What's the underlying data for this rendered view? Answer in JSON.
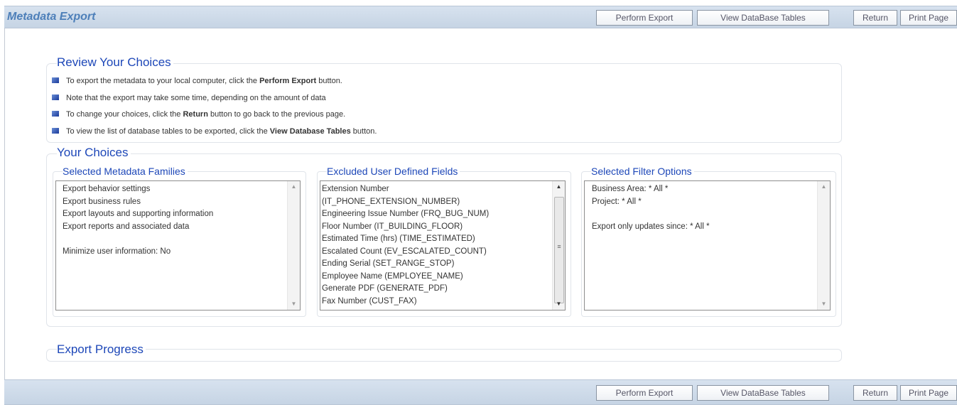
{
  "header": {
    "title": "Metadata Export"
  },
  "toolbar": {
    "perform_export": "Perform Export",
    "view_tables": "View DataBase Tables",
    "return": "Return",
    "print_page": "Print Page"
  },
  "review": {
    "legend": "Review Your Choices",
    "bullets": [
      {
        "pre": "To export the metadata to your local computer, click the ",
        "bold": "Perform Export",
        "post": " button."
      },
      {
        "pre": "Note that the export may take some time, depending on the amount of data",
        "bold": "",
        "post": ""
      },
      {
        "pre": "To change your choices, click the ",
        "bold": "Return",
        "post": " button to go back to the previous page."
      },
      {
        "pre": "To view the list of database tables to be exported, click the ",
        "bold": "View Database Tables",
        "post": " button."
      }
    ]
  },
  "choices": {
    "legend": "Your Choices",
    "families": {
      "legend": "Selected Metadata Families",
      "items": [
        "Export behavior settings",
        "Export business rules",
        "Export layouts and supporting information",
        "Export reports and associated data",
        "",
        "Minimize user information: No"
      ]
    },
    "excluded": {
      "legend": "Excluded User Defined Fields",
      "items": [
        "Extension Number",
        "(IT_PHONE_EXTENSION_NUMBER)",
        "Engineering Issue Number (FRQ_BUG_NUM)",
        "Floor Number (IT_BUILDING_FLOOR)",
        "Estimated Time (hrs) (TIME_ESTIMATED)",
        "Escalated Count (EV_ESCALATED_COUNT)",
        "Ending Serial (SET_RANGE_STOP)",
        "Employee Name (EMPLOYEE_NAME)",
        "Generate PDF (GENERATE_PDF)",
        "Fax Number (CUST_FAX)"
      ]
    },
    "filters": {
      "legend": "Selected Filter Options",
      "items": [
        "Business Area: * All *",
        "Project: * All *",
        "",
        "Export only updates since: * All *"
      ]
    }
  },
  "progress": {
    "legend": "Export Progress"
  },
  "colors": {
    "accent": "#1d47b8",
    "title": "#4d7fb9",
    "bar": "#c6d4e4"
  }
}
